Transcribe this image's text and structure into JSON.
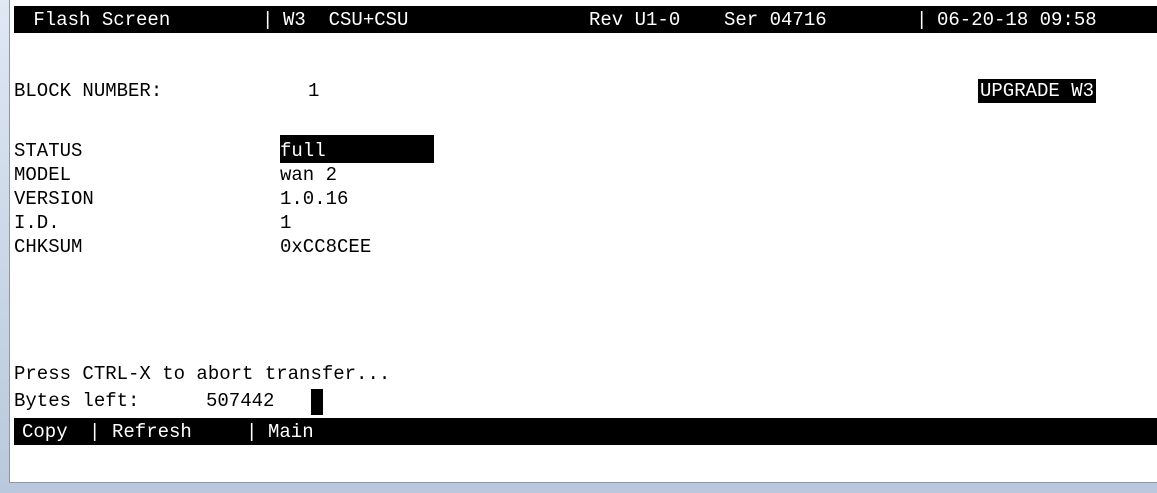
{
  "header": {
    "screen_name": " Flash Screen",
    "sep1": "|",
    "unit": "W3  CSU+CSU",
    "rev": "Rev U1-0",
    "serial": "Ser 04716",
    "sep2": "|",
    "datetime": "06-20-18 09:58"
  },
  "block": {
    "label": "BLOCK NUMBER:",
    "value": "1",
    "action": "UPGRADE W3"
  },
  "fields": [
    {
      "label": "STATUS",
      "value": "full"
    },
    {
      "label": "MODEL",
      "value": "wan 2"
    },
    {
      "label": "VERSION",
      "value": "1.0.16"
    },
    {
      "label": "I.D.",
      "value": "1"
    },
    {
      "label": "CHKSUM",
      "value": "0xCC8CEE"
    }
  ],
  "transfer": {
    "hint": "Press CTRL-X to abort transfer...",
    "bytes_label": "Bytes left:",
    "bytes_value": "507442"
  },
  "menu": {
    "copy": "Copy",
    "sep1": "|",
    "refresh": "Refresh",
    "sep2": "|",
    "main": "Main"
  }
}
